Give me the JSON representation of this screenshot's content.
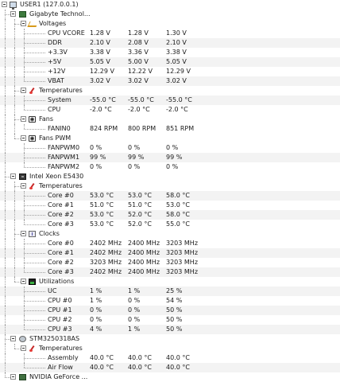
{
  "tree": [
    {
      "label": "USER1 (127.0.0.1)",
      "indent": 0,
      "icon": "computer-icon",
      "toggle": true
    },
    {
      "label": "Gigabyte Technol...",
      "indent": 1,
      "icon": "motherboard-icon",
      "toggle": true
    },
    {
      "label": "Voltages",
      "indent": 2,
      "icon": "voltage-icon",
      "toggle": true
    },
    {
      "label": "CPU VCORE",
      "indent": 3,
      "values": [
        "1.28 V",
        "1.28 V",
        "1.30 V"
      ]
    },
    {
      "label": "DDR",
      "indent": 3,
      "values": [
        "2.10 V",
        "2.08 V",
        "2.10 V"
      ]
    },
    {
      "label": "+3.3V",
      "indent": 3,
      "values": [
        "3.38 V",
        "3.36 V",
        "3.38 V"
      ]
    },
    {
      "label": "+5V",
      "indent": 3,
      "values": [
        "5.05 V",
        "5.00 V",
        "5.05 V"
      ]
    },
    {
      "label": "+12V",
      "indent": 3,
      "values": [
        "12.29 V",
        "12.22 V",
        "12.29 V"
      ]
    },
    {
      "label": "VBAT",
      "indent": 3,
      "values": [
        "3.02 V",
        "3.02 V",
        "3.02 V"
      ]
    },
    {
      "label": "Temperatures",
      "indent": 2,
      "icon": "thermometer-icon",
      "toggle": true
    },
    {
      "label": "System",
      "indent": 3,
      "values": [
        "-55.0 °C",
        "-55.0 °C",
        "-55.0 °C"
      ]
    },
    {
      "label": "CPU",
      "indent": 3,
      "values": [
        "-2.0 °C",
        "-2.0 °C",
        "-2.0 °C"
      ]
    },
    {
      "label": "Fans",
      "indent": 2,
      "icon": "fan-icon",
      "toggle": true
    },
    {
      "label": "FANIN0",
      "indent": 3,
      "values": [
        "824 RPM",
        "800 RPM",
        "851 RPM"
      ]
    },
    {
      "label": "Fans PWM",
      "indent": 2,
      "icon": "fan-icon",
      "toggle": true
    },
    {
      "label": "FANPWM0",
      "indent": 3,
      "values": [
        "0 %",
        "0 %",
        "0 %"
      ]
    },
    {
      "label": "FANPWM1",
      "indent": 3,
      "values": [
        "99 %",
        "99 %",
        "99 %"
      ]
    },
    {
      "label": "FANPWM2",
      "indent": 3,
      "values": [
        "0 %",
        "0 %",
        "0 %"
      ]
    },
    {
      "label": "Intel Xeon E5430",
      "indent": 1,
      "icon": "cpu-icon",
      "toggle": true
    },
    {
      "label": "Temperatures",
      "indent": 2,
      "icon": "thermometer-icon",
      "toggle": true
    },
    {
      "label": "Core #0",
      "indent": 3,
      "values": [
        "53.0 °C",
        "53.0 °C",
        "58.0 °C"
      ]
    },
    {
      "label": "Core #1",
      "indent": 3,
      "values": [
        "51.0 °C",
        "51.0 °C",
        "53.0 °C"
      ]
    },
    {
      "label": "Core #2",
      "indent": 3,
      "values": [
        "53.0 °C",
        "52.0 °C",
        "58.0 °C"
      ]
    },
    {
      "label": "Core #3",
      "indent": 3,
      "values": [
        "53.0 °C",
        "52.0 °C",
        "55.0 °C"
      ]
    },
    {
      "label": "Clocks",
      "indent": 2,
      "icon": "clock-icon",
      "toggle": true
    },
    {
      "label": "Core #0",
      "indent": 3,
      "values": [
        "2402 MHz",
        "2400 MHz",
        "3203 MHz"
      ]
    },
    {
      "label": "Core #1",
      "indent": 3,
      "values": [
        "2402 MHz",
        "2400 MHz",
        "3203 MHz"
      ]
    },
    {
      "label": "Core #2",
      "indent": 3,
      "values": [
        "3203 MHz",
        "2400 MHz",
        "3203 MHz"
      ]
    },
    {
      "label": "Core #3",
      "indent": 3,
      "values": [
        "2402 MHz",
        "2400 MHz",
        "3203 MHz"
      ]
    },
    {
      "label": "Utilizations",
      "indent": 2,
      "icon": "utilization-icon",
      "toggle": true
    },
    {
      "label": "UC",
      "indent": 3,
      "values": [
        "1 %",
        "1 %",
        "25 %"
      ]
    },
    {
      "label": "CPU #0",
      "indent": 3,
      "values": [
        "1 %",
        "0 %",
        "54 %"
      ]
    },
    {
      "label": "CPU #1",
      "indent": 3,
      "values": [
        "0 %",
        "0 %",
        "50 %"
      ]
    },
    {
      "label": "CPU #2",
      "indent": 3,
      "values": [
        "0 %",
        "0 %",
        "50 %"
      ]
    },
    {
      "label": "CPU #3",
      "indent": 3,
      "values": [
        "4 %",
        "1 %",
        "50 %"
      ]
    },
    {
      "label": "STM3250318AS",
      "indent": 1,
      "icon": "hard-disk-icon",
      "toggle": true
    },
    {
      "label": "Temperatures",
      "indent": 2,
      "icon": "thermometer-icon",
      "toggle": true
    },
    {
      "label": "Assembly",
      "indent": 3,
      "values": [
        "40.0 °C",
        "40.0 °C",
        "40.0 °C"
      ]
    },
    {
      "label": "Air Flow",
      "indent": 3,
      "values": [
        "40.0 °C",
        "40.0 °C",
        "40.0 °C"
      ]
    },
    {
      "label": "NVIDIA GeForce ...",
      "indent": 1,
      "icon": "graphics-card-icon",
      "toggle": true
    }
  ],
  "colors": {
    "background": "#ffffff",
    "alt_row": "#f3f3f3",
    "guide_line": "#a0a0a0",
    "text": "#1a1a1a"
  }
}
